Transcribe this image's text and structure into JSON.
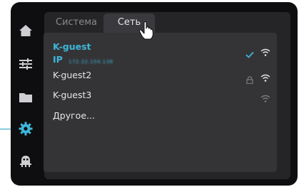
{
  "tabs": {
    "system": "Система",
    "network": "Сеть"
  },
  "networks": [
    {
      "ssid": "K-guest",
      "ip_label": "IP",
      "ip_value": "172.22.154.136",
      "connected": true,
      "locked": false
    },
    {
      "ssid": "K-guest2",
      "connected": false,
      "locked": true
    },
    {
      "ssid": "K-guest3",
      "connected": false,
      "locked": false
    }
  ],
  "other_label": "Другое...",
  "sidebar": [
    "home-icon",
    "sliders-icon",
    "folder-icon",
    "gear-icon",
    "robot-icon"
  ],
  "colors": {
    "accent": "#3fb7d9",
    "background": "#0e0e10",
    "panel": "#343437"
  }
}
